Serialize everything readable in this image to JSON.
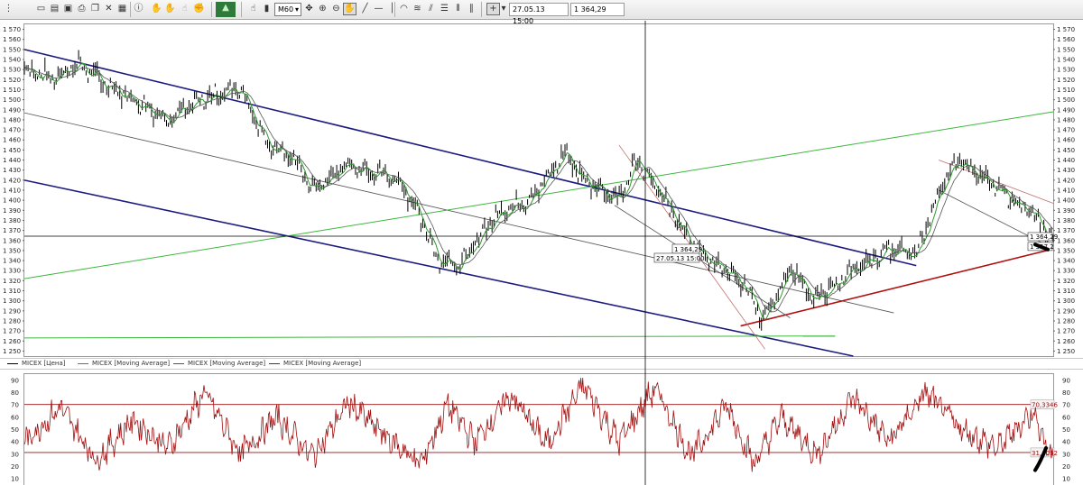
{
  "toolbar": {
    "timeframe": "M60",
    "cursor_datetime": "27.05.13 15:00",
    "cursor_price": "1 364,29"
  },
  "legend": [
    {
      "label": "MICEX [Цена]",
      "color": "#000000"
    },
    {
      "label": "MICEX [Moving Average]",
      "color": "#2e9a2e"
    },
    {
      "label": "MICEX [Moving Average]",
      "color": "#555555"
    },
    {
      "label": "MICEX [Moving Average]",
      "color": "#3c3c3c"
    }
  ],
  "colors": {
    "price": "#000000",
    "ma_fast": "#2e9a2e",
    "ma_slow": "#555555",
    "rsi": "#a01010",
    "channel_blue": "#1c1c80",
    "trend_green": "#3cb83c",
    "support_red": "#b01010",
    "channel_red_thin": "#c07070",
    "grey_line": "#555555"
  },
  "chart_data": [
    {
      "type": "line",
      "panel": "price",
      "y_ticks": [
        "1 570",
        "1 560",
        "1 550",
        "1 540",
        "1 530",
        "1 520",
        "1 510",
        "1 500",
        "1 490",
        "1 480",
        "1 470",
        "1 460",
        "1 450",
        "1 440",
        "1 430",
        "1 420",
        "1 410",
        "1 400",
        "1 390",
        "1 380",
        "1 370",
        "1 360",
        "1 350",
        "1 340",
        "1 330",
        "1 320",
        "1 310",
        "1 300",
        "1 290",
        "1 280",
        "1 270",
        "1 260",
        "1 250"
      ],
      "ylim": [
        1245,
        1575
      ],
      "price_path": [
        [
          0,
          1530
        ],
        [
          30,
          1520
        ],
        [
          60,
          1535
        ],
        [
          90,
          1515
        ],
        [
          120,
          1500
        ],
        [
          160,
          1480
        ],
        [
          200,
          1500
        ],
        [
          240,
          1512
        ],
        [
          250,
          1490
        ],
        [
          270,
          1455
        ],
        [
          300,
          1440
        ],
        [
          320,
          1410
        ],
        [
          360,
          1435
        ],
        [
          400,
          1425
        ],
        [
          420,
          1415
        ],
        [
          440,
          1380
        ],
        [
          460,
          1340
        ],
        [
          480,
          1335
        ],
        [
          500,
          1355
        ],
        [
          520,
          1380
        ],
        [
          560,
          1400
        ],
        [
          600,
          1445
        ],
        [
          620,
          1420
        ],
        [
          660,
          1400
        ],
        [
          680,
          1440
        ],
        [
          720,
          1385
        ],
        [
          740,
          1355
        ],
        [
          770,
          1335
        ],
        [
          800,
          1315
        ],
        [
          820,
          1280
        ],
        [
          850,
          1330
        ],
        [
          880,
          1300
        ],
        [
          920,
          1330
        ],
        [
          960,
          1350
        ],
        [
          990,
          1345
        ],
        [
          1020,
          1420
        ],
        [
          1040,
          1438
        ],
        [
          1080,
          1410
        ],
        [
          1120,
          1385
        ],
        [
          1142,
          1360
        ]
      ],
      "series": [
        {
          "name": "MICEX [Цена]"
        },
        {
          "name": "MICEX [Moving Average]"
        },
        {
          "name": "MICEX [Moving Average]"
        }
      ],
      "trend_lines": [
        {
          "kind": "channel-upper",
          "from": [
            0,
            1550
          ],
          "to": [
            990,
            1335
          ]
        },
        {
          "kind": "channel-lower",
          "from": [
            0,
            1420
          ],
          "to": [
            920,
            1245
          ]
        },
        {
          "kind": "mid-line",
          "from": [
            0,
            1487
          ],
          "to": [
            965,
            1288
          ]
        },
        {
          "kind": "rising-green",
          "from": [
            0,
            1322
          ],
          "to": [
            1142,
            1488
          ]
        },
        {
          "kind": "flat-green",
          "from": [
            0,
            1263
          ],
          "to": [
            900,
            1265
          ]
        },
        {
          "kind": "red-support",
          "from": [
            795,
            1275
          ],
          "to": [
            1135,
            1350
          ]
        },
        {
          "kind": "descending-channel-upper",
          "from": [
            660,
            1455
          ],
          "to": [
            822,
            1252
          ]
        },
        {
          "kind": "descending-channel-lower",
          "from": [
            655,
            1395
          ],
          "to": [
            850,
            1283
          ]
        },
        {
          "kind": "right-channel-upper",
          "from": [
            1015,
            1440
          ],
          "to": [
            1142,
            1397
          ]
        },
        {
          "kind": "right-channel-lower",
          "from": [
            1015,
            1410
          ],
          "to": [
            1142,
            1352
          ]
        }
      ],
      "crosshair": {
        "x_time": "27.05.13 15:00",
        "price": 1364.29,
        "label_price": "1 364,29",
        "label_time": "27.05.13 15:00"
      },
      "last_price_labels": [
        "1 364,29",
        "1 357,2"
      ]
    },
    {
      "type": "line",
      "panel": "oscillator",
      "y_ticks": [
        "90",
        "80",
        "70",
        "60",
        "50",
        "40",
        "30",
        "20",
        "10"
      ],
      "ylim": [
        5,
        95
      ],
      "levels": [
        {
          "value": 70.33,
          "label": "70,3346"
        },
        {
          "value": 31.41,
          "label": "31,4052"
        }
      ],
      "series": [
        {
          "name": "MICEX [Moving Average]"
        }
      ],
      "rsi_anchors": [
        [
          0,
          40
        ],
        [
          40,
          68
        ],
        [
          80,
          25
        ],
        [
          120,
          58
        ],
        [
          160,
          35
        ],
        [
          200,
          80
        ],
        [
          240,
          30
        ],
        [
          280,
          60
        ],
        [
          320,
          28
        ],
        [
          360,
          72
        ],
        [
          400,
          45
        ],
        [
          440,
          22
        ],
        [
          470,
          70
        ],
        [
          500,
          40
        ],
        [
          540,
          78
        ],
        [
          580,
          38
        ],
        [
          620,
          86
        ],
        [
          660,
          40
        ],
        [
          700,
          84
        ],
        [
          740,
          28
        ],
        [
          780,
          70
        ],
        [
          810,
          22
        ],
        [
          840,
          60
        ],
        [
          880,
          30
        ],
        [
          920,
          76
        ],
        [
          960,
          40
        ],
        [
          1000,
          80
        ],
        [
          1040,
          50
        ],
        [
          1080,
          35
        ],
        [
          1120,
          65
        ],
        [
          1142,
          22
        ]
      ]
    }
  ]
}
